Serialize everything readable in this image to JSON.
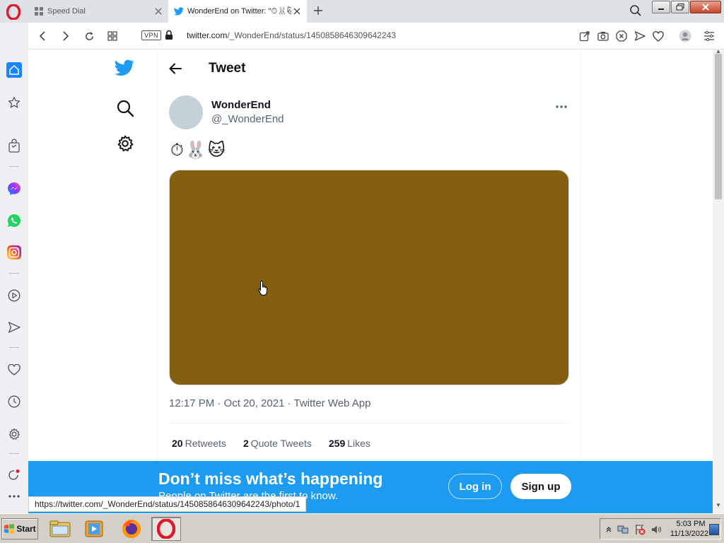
{
  "browser": {
    "tabs": [
      {
        "title": "Speed Dial",
        "active": false
      },
      {
        "title": "WonderEnd on Twitter: \"⏱🐰🐱\"",
        "active": true
      }
    ],
    "url_host": "twitter.com",
    "url_path": "/_WonderEnd/status/1450858646309642243",
    "vpn_label": "VPN",
    "status_url": "https://twitter.com/_WonderEnd/status/1450858646309642243/photo/1"
  },
  "header": {
    "title": "Tweet"
  },
  "tweet": {
    "display_name": "WonderEnd",
    "handle": "@_WonderEnd",
    "text": "⏱🐰🐱",
    "media_color": "#855f10",
    "meta": "12:17 PM · Oct 20, 2021 · Twitter Web App",
    "stats": [
      {
        "count": "20",
        "label": "Retweets"
      },
      {
        "count": "2",
        "label": "Quote Tweets"
      },
      {
        "count": "259",
        "label": "Likes"
      }
    ]
  },
  "banner": {
    "heading": "Don’t miss what’s happening",
    "subtext": "People on Twitter are the first to know.",
    "login_label": "Log in",
    "signup_label": "Sign up",
    "color": "#1d9bf0"
  },
  "taskbar": {
    "start_label": "Start",
    "clock_time": "5:03 PM",
    "clock_date": "11/13/2022"
  },
  "icons": {
    "sidebar": [
      "home-icon",
      "speed-dial-icon",
      "shopping-icon",
      "messenger-icon",
      "whatsapp-icon",
      "instagram-icon",
      "player-icon",
      "send-icon",
      "heart-icon",
      "history-icon",
      "settings-icon",
      "more-icon"
    ],
    "toolbar": [
      "snap-icon",
      "camera-icon",
      "adblock-icon",
      "flow-icon",
      "heart-icon",
      "profile-icon",
      "easy-setup-icon"
    ]
  }
}
